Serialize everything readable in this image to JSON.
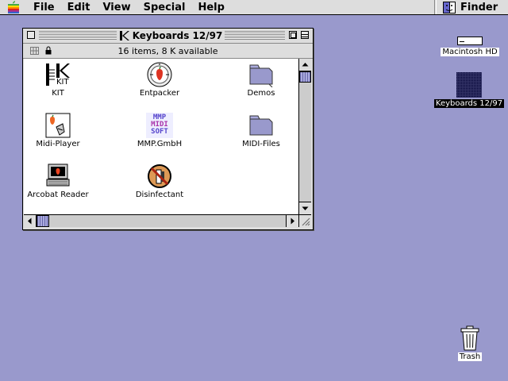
{
  "menubar": {
    "items": [
      "File",
      "Edit",
      "View",
      "Special",
      "Help"
    ],
    "active_app": "Finder"
  },
  "window": {
    "title": "Keyboards 12/97",
    "header_info": "16 items, 8 K available",
    "files": [
      {
        "label": "KIT",
        "icon": "kit-app-icon"
      },
      {
        "label": "Entpacker",
        "icon": "entpacker-app-icon"
      },
      {
        "label": "Demos",
        "icon": "folder-icon"
      },
      {
        "label": "Midi-Player",
        "icon": "midi-player-app-icon"
      },
      {
        "label": "MMP.GmbH",
        "icon": "mmp-midi-soft-icon"
      },
      {
        "label": "MIDI-Files",
        "icon": "folder-icon"
      },
      {
        "label": "Arcobat Reader",
        "icon": "acrobat-reader-icon"
      },
      {
        "label": "Disinfectant",
        "icon": "disinfectant-app-icon"
      }
    ],
    "kit_icon_text": "KIT",
    "mmp_icon_lines": [
      "MMP",
      "MIDI",
      "SOFT"
    ]
  },
  "desktop": {
    "hard_disk_label": "Macintosh HD",
    "disk_label": "Keyboards 12/97",
    "trash_label": "Trash"
  },
  "colors": {
    "desktop": "#9999cc",
    "chrome": "#dddddd"
  }
}
